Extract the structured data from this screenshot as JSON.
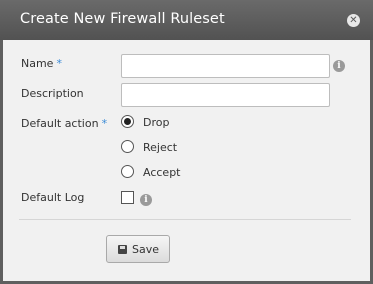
{
  "dialog": {
    "title": "Create New Firewall Ruleset",
    "close_icon": "close-icon"
  },
  "form": {
    "name_label": "Name",
    "name_value": "",
    "description_label": "Description",
    "description_value": "",
    "default_action_label": "Default action",
    "required_marker": "*",
    "default_action_options": [
      "Drop",
      "Reject",
      "Accept"
    ],
    "default_action_selected": "Drop",
    "default_log_label": "Default Log",
    "default_log_checked": false,
    "info_icon": "info-icon",
    "info_glyph": "i"
  },
  "footer": {
    "save_label": "Save",
    "save_icon": "floppy-disk-icon"
  },
  "colors": {
    "title_bar": "#5a5a5a",
    "required_marker": "#3a8ad6",
    "background": "#f1f1f1"
  }
}
